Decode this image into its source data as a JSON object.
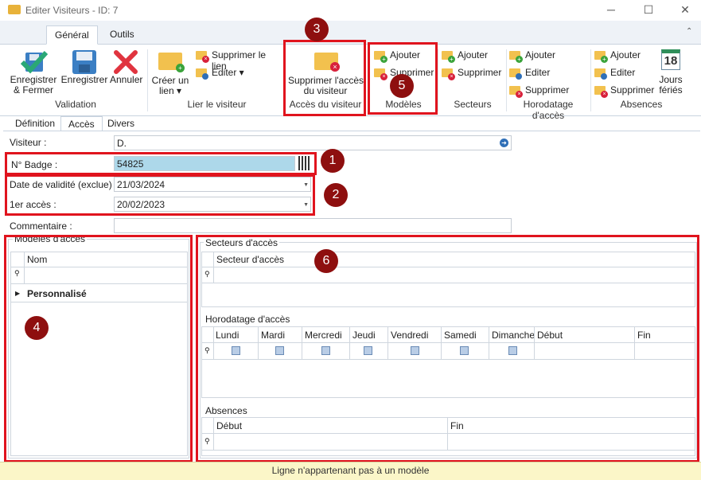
{
  "window": {
    "title": "Editer Visiteurs - ID: 7",
    "minimize": "─",
    "maximize": "☐",
    "close": "✕"
  },
  "ribbon": {
    "tabs": [
      "Général",
      "Outils"
    ],
    "validation": {
      "save_close": "Enregistrer\n& Fermer",
      "save": "Enregistrer",
      "cancel": "Annuler",
      "label": "Validation"
    },
    "lier": {
      "create": "Créer un\nlien ▾",
      "delete_link": "Supprimer le lien",
      "edit": "Editer  ▾",
      "label": "Lier le visiteur"
    },
    "acces": {
      "delete_access": "Supprimer l'accès\ndu visiteur",
      "label": "Accès du visiteur"
    },
    "modeles": {
      "add": "Ajouter",
      "delete": "Supprimer",
      "label": "Modèles"
    },
    "secteurs": {
      "add": "Ajouter",
      "delete": "Supprimer",
      "label": "Secteurs"
    },
    "horodatage": {
      "add": "Ajouter",
      "edit": "Editer",
      "delete": "Supprimer",
      "label": "Horodatage d'accès"
    },
    "absences": {
      "add": "Ajouter",
      "edit": "Editer",
      "delete": "Supprimer",
      "holidays": "Jours\nfériés",
      "holidays_day": "18",
      "label": "Absences"
    }
  },
  "form_tabs": [
    "Définition",
    "Accès",
    "Divers"
  ],
  "form": {
    "visiteur_label": "Visiteur :",
    "visiteur_value": "D.",
    "badge_label": "N° Badge :",
    "badge_value": "54825",
    "validite_label": "Date de validité (exclue) :",
    "validite_value": "21/03/2024",
    "premier_label": "1er accès :",
    "premier_value": "20/02/2023",
    "commentaire_label": "Commentaire :",
    "commentaire_value": ""
  },
  "modeles_panel": {
    "title": "Modèles d'accès",
    "col_nom": "Nom",
    "rows": [
      "Personnalisé"
    ]
  },
  "secteurs_panel": {
    "title": "Secteurs d'accès",
    "col": "Secteur d'accès"
  },
  "horodatage_panel": {
    "title": "Horodatage d'accès",
    "cols": [
      "Lundi",
      "Mardi",
      "Mercredi",
      "Jeudi",
      "Vendredi",
      "Samedi",
      "Dimanche",
      "Début",
      "Fin"
    ]
  },
  "absences_panel": {
    "title": "Absences",
    "cols": [
      "Début",
      "Fin"
    ]
  },
  "callouts": [
    "1",
    "2",
    "3",
    "4",
    "5",
    "6"
  ],
  "status": "Ligne n'appartenant pas à un modèle",
  "colors": {
    "highlight": "#e0141e",
    "callout": "#8e0f0f",
    "selected_input": "#add8ea",
    "status_bg": "#fbf6c8"
  }
}
